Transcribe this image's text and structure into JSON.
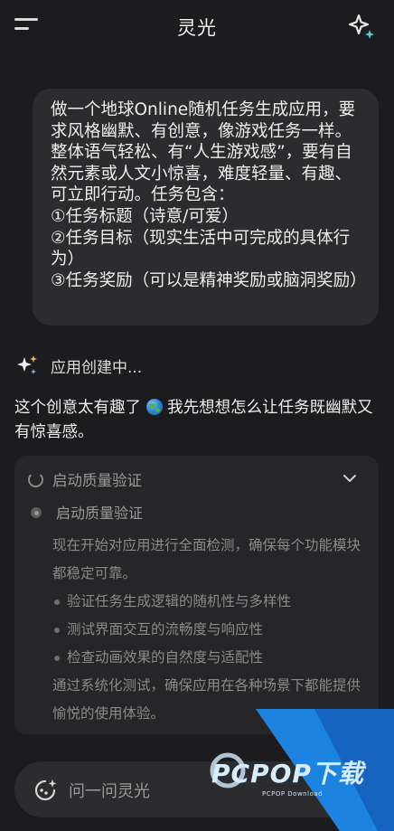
{
  "header": {
    "title": "灵光"
  },
  "user_message": {
    "lines": [
      "做一个地球Online随机任务生成应用，要求风格幽默、有创意，像游戏任务一样。整体语气轻松、有“人生游戏感”，要有自然元素或人文小惊喜，难度轻量、有趣、可立即行动。任务包含：",
      "①任务标题（诗意/可爱）",
      "②任务目标（现实生活中可完成的具体行为）",
      "③任务奖励（可以是精神奖励或脑洞奖励）"
    ]
  },
  "status": {
    "text": "应用创建中..."
  },
  "assistant": {
    "reply_before_emoji": "这个创意太有趣了",
    "reply_after_emoji": "我先想想怎么让任务既幽默又有惊喜感。"
  },
  "progress_card": {
    "header_title": "启动质量验证",
    "step_title": "启动质量验证",
    "intro": "现在开始对应用进行全面检测，确保每个功能模块都稳定可靠。",
    "bullets": [
      "验证任务生成逻辑的随机性与多样性",
      "测试界面交互的流畅度与响应性",
      "检查动画效果的自然度与适配性"
    ],
    "outro": "通过系统化测试，确保应用在各种场景下都能提供愉悦的使用体验。"
  },
  "input": {
    "placeholder": "问一问灵光"
  },
  "watermark": {
    "logo": "PCPOP下载",
    "subtitle": "PCPOP Download"
  },
  "colors": {
    "background": "#1c1c1e",
    "bubble": "#2c2c2e",
    "card": "#262628",
    "accent": "#4fd1c5"
  }
}
